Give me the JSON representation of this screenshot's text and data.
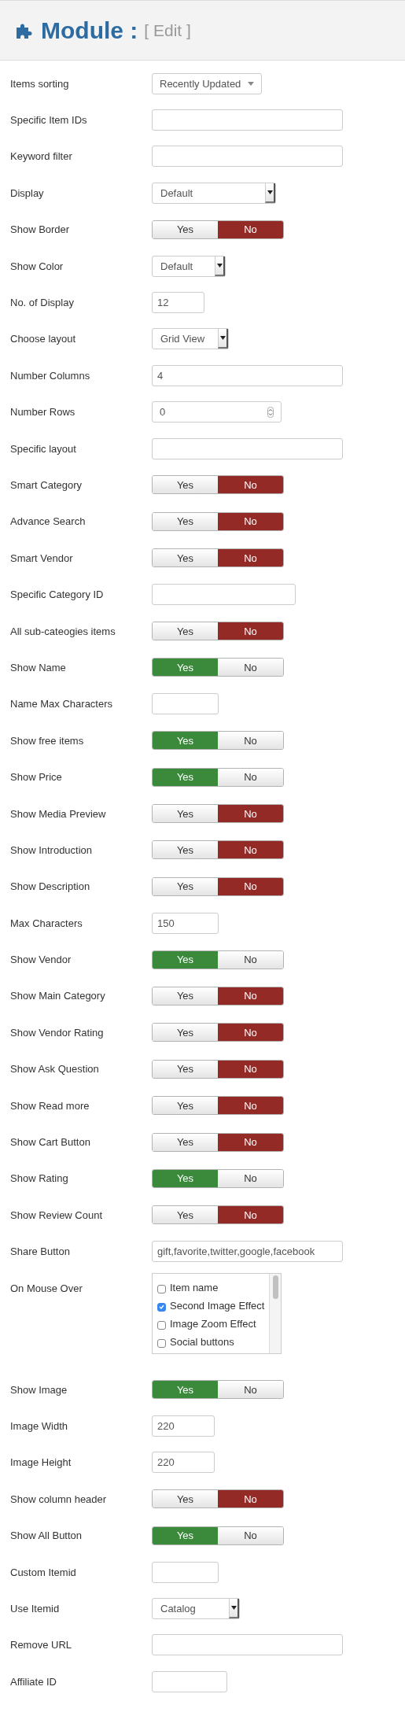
{
  "header": {
    "title": "Module :",
    "subtitle": "[ Edit ]"
  },
  "fields": [
    {
      "label": "Items sorting",
      "kind": "select",
      "value": "Recently Updated"
    },
    {
      "label": "Specific Item IDs",
      "kind": "text"
    },
    {
      "label": "Keyword filter",
      "kind": "text"
    },
    {
      "label": "Display",
      "kind": "combo",
      "value": "Default"
    },
    {
      "label": "Show Border",
      "kind": "toggle",
      "options": [
        {
          "label": "Yes",
          "selected": false
        },
        {
          "label": "No",
          "selected": true
        }
      ]
    },
    {
      "label": "Show Color",
      "kind": "combo",
      "value": "Default"
    },
    {
      "label": "No. of Display",
      "kind": "text",
      "value": "12"
    },
    {
      "label": "Choose layout",
      "kind": "combo",
      "value": "Grid View"
    },
    {
      "label": "Number Columns",
      "kind": "text",
      "value": "4"
    },
    {
      "label": "Number Rows",
      "kind": "number",
      "value": "0"
    },
    {
      "label": "Specific layout",
      "kind": "text"
    },
    {
      "label": "Smart Category",
      "kind": "toggle",
      "options": [
        {
          "label": "Yes",
          "selected": false
        },
        {
          "label": "No",
          "selected": true
        }
      ]
    },
    {
      "label": "Advance Search",
      "kind": "toggle",
      "options": [
        {
          "label": "Yes",
          "selected": false
        },
        {
          "label": "No",
          "selected": true
        }
      ]
    },
    {
      "label": "Smart Vendor",
      "kind": "toggle",
      "options": [
        {
          "label": "Yes",
          "selected": false
        },
        {
          "label": "No",
          "selected": true
        }
      ]
    },
    {
      "label": "Specific Category ID",
      "kind": "text"
    },
    {
      "label": "All sub-cateogies items",
      "kind": "toggle",
      "options": [
        {
          "label": "Yes",
          "selected": false
        },
        {
          "label": "No",
          "selected": true
        }
      ]
    },
    {
      "label": "Show Name",
      "kind": "toggle",
      "options": [
        {
          "label": "Yes",
          "selected": true
        },
        {
          "label": "No",
          "selected": false
        }
      ]
    },
    {
      "label": "Name Max Characters",
      "kind": "text"
    },
    {
      "label": "Show free items",
      "kind": "toggle",
      "options": [
        {
          "label": "Yes",
          "selected": true
        },
        {
          "label": "No",
          "selected": false
        }
      ]
    },
    {
      "label": "Show Price",
      "kind": "toggle",
      "options": [
        {
          "label": "Yes",
          "selected": true
        },
        {
          "label": "No",
          "selected": false
        }
      ]
    },
    {
      "label": "Show Media Preview",
      "kind": "toggle",
      "options": [
        {
          "label": "Yes",
          "selected": false
        },
        {
          "label": "No",
          "selected": true
        }
      ]
    },
    {
      "label": "Show Introduction",
      "kind": "toggle",
      "options": [
        {
          "label": "Yes",
          "selected": false
        },
        {
          "label": "No",
          "selected": true
        }
      ]
    },
    {
      "label": "Show Description",
      "kind": "toggle",
      "options": [
        {
          "label": "Yes",
          "selected": false
        },
        {
          "label": "No",
          "selected": true
        }
      ]
    },
    {
      "label": "Max Characters",
      "kind": "text",
      "value": "150"
    },
    {
      "label": "Show Vendor",
      "kind": "toggle",
      "options": [
        {
          "label": "Yes",
          "selected": true
        },
        {
          "label": "No",
          "selected": false
        }
      ]
    },
    {
      "label": "Show Main Category",
      "kind": "toggle",
      "options": [
        {
          "label": "Yes",
          "selected": false
        },
        {
          "label": "No",
          "selected": true
        }
      ]
    },
    {
      "label": "Show Vendor Rating",
      "kind": "toggle",
      "options": [
        {
          "label": "Yes",
          "selected": false
        },
        {
          "label": "No",
          "selected": true
        }
      ]
    },
    {
      "label": "Show Ask Question",
      "kind": "toggle",
      "options": [
        {
          "label": "Yes",
          "selected": false
        },
        {
          "label": "No",
          "selected": true
        }
      ]
    },
    {
      "label": "Show Read more",
      "kind": "toggle",
      "options": [
        {
          "label": "Yes",
          "selected": false
        },
        {
          "label": "No",
          "selected": true
        }
      ]
    },
    {
      "label": "Show Cart Button",
      "kind": "toggle",
      "options": [
        {
          "label": "Yes",
          "selected": false
        },
        {
          "label": "No",
          "selected": true
        }
      ]
    },
    {
      "label": "Show Rating",
      "kind": "toggle",
      "options": [
        {
          "label": "Yes",
          "selected": true
        },
        {
          "label": "No",
          "selected": false
        }
      ]
    },
    {
      "label": "Show Review Count",
      "kind": "toggle",
      "options": [
        {
          "label": "Yes",
          "selected": false
        },
        {
          "label": "No",
          "selected": true
        }
      ]
    },
    {
      "label": "Share Button",
      "kind": "text",
      "value": "gift,favorite,twitter,google,facebook"
    },
    {
      "label": "On Mouse Over",
      "kind": "checklist",
      "items": [
        {
          "label": "Item name",
          "checked": false
        },
        {
          "label": "Second Image Effect",
          "checked": true
        },
        {
          "label": "Image Zoom Effect",
          "checked": false
        },
        {
          "label": "Social buttons",
          "checked": false
        }
      ]
    },
    {
      "label": "Show Image",
      "kind": "toggle",
      "options": [
        {
          "label": "Yes",
          "selected": true
        },
        {
          "label": "No",
          "selected": false
        }
      ]
    },
    {
      "label": "Image Width",
      "kind": "text",
      "value": "220"
    },
    {
      "label": "Image Height",
      "kind": "text",
      "value": "220"
    },
    {
      "label": "Show column header",
      "kind": "toggle",
      "options": [
        {
          "label": "Yes",
          "selected": false
        },
        {
          "label": "No",
          "selected": true
        }
      ]
    },
    {
      "label": "Show All Button",
      "kind": "toggle",
      "options": [
        {
          "label": "Yes",
          "selected": true
        },
        {
          "label": "No",
          "selected": false
        }
      ]
    },
    {
      "label": "Custom Itemid",
      "kind": "text"
    },
    {
      "label": "Use Itemid",
      "kind": "combo",
      "value": "Catalog"
    },
    {
      "label": "Remove URL",
      "kind": "text"
    },
    {
      "label": "Affiliate ID",
      "kind": "text"
    }
  ]
}
